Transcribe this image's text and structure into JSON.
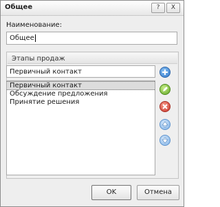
{
  "window": {
    "title": "Общее",
    "help_label": "?",
    "close_label": "X"
  },
  "name_field": {
    "label": "Наименование:",
    "value": "Общее"
  },
  "stages": {
    "title": "Этапы продаж",
    "input_value": "Первичный контакт",
    "items": [
      "Первичный контакт",
      "Обсуждение предложения",
      "Принятие решения"
    ],
    "selected_index": 0,
    "icons": [
      "add-icon",
      "edit-icon",
      "delete-icon",
      "move-up-icon",
      "move-down-icon"
    ]
  },
  "buttons": {
    "ok_label": "OK",
    "cancel_label": "Отмена"
  }
}
